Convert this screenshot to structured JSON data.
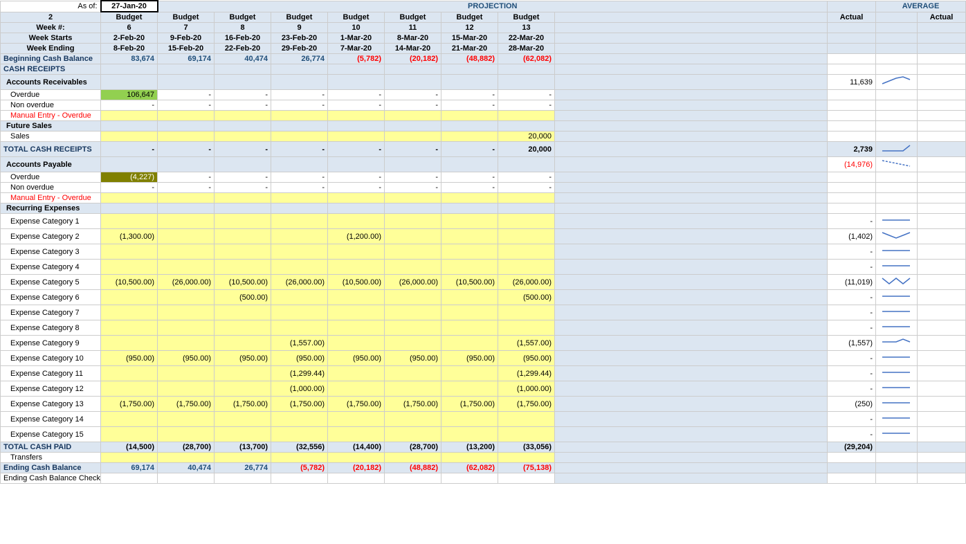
{
  "header": {
    "as_of_label": "As of:",
    "as_of_value": "27-Jan-20",
    "row2": "2",
    "projection_label": "PROJECTION",
    "average_label": "AVERAGE",
    "week_label": "Week #:",
    "week_starts": "Week Starts",
    "week_ending": "Week Ending",
    "col_actual1": "Actual",
    "col_actual2": "Actual"
  },
  "columns": [
    {
      "budget": "Budget",
      "week": "6",
      "start": "2-Feb-20",
      "end": "8-Feb-20"
    },
    {
      "budget": "Budget",
      "week": "7",
      "start": "9-Feb-20",
      "end": "15-Feb-20"
    },
    {
      "budget": "Budget",
      "week": "8",
      "start": "16-Feb-20",
      "end": "22-Feb-20"
    },
    {
      "budget": "Budget",
      "week": "9",
      "start": "23-Feb-20",
      "end": "29-Feb-20"
    },
    {
      "budget": "Budget",
      "week": "10",
      "start": "1-Mar-20",
      "end": "7-Mar-20"
    },
    {
      "budget": "Budget",
      "week": "11",
      "start": "8-Mar-20",
      "end": "14-Mar-20"
    },
    {
      "budget": "Budget",
      "week": "12",
      "start": "15-Mar-20",
      "end": "21-Mar-20"
    },
    {
      "budget": "Budget",
      "week": "13",
      "start": "22-Mar-20",
      "end": "28-Mar-20"
    }
  ],
  "rows": {
    "beginning_cash_balance": {
      "label": "Beginning Cash Balance",
      "values": [
        "83,674",
        "69,174",
        "40,474",
        "26,774",
        "(5,782)",
        "(20,182)",
        "(48,882)",
        "(62,082)"
      ],
      "red": [
        false,
        false,
        false,
        false,
        true,
        true,
        true,
        true
      ]
    },
    "cash_receipts": "CASH RECEIPTS",
    "accounts_receivables": "Accounts Receivables",
    "overdue_ar": {
      "label": "Overdue",
      "cell_value": "106,647",
      "values": [
        "-",
        "-",
        "-",
        "-",
        "-",
        "-",
        "-",
        "-"
      ],
      "avg": "11,639"
    },
    "non_overdue_ar": {
      "label": "Non overdue",
      "values": [
        "-",
        "-",
        "-",
        "-",
        "-",
        "-",
        "-",
        "-"
      ]
    },
    "manual_entry_overdue_ar": "Manual Entry - Overdue",
    "future_sales": "Future Sales",
    "sales": {
      "label": "Sales",
      "values": [
        "",
        "",
        "",
        "",
        "",
        "",
        "",
        "20,000"
      ],
      "avg": ""
    },
    "total_cash_receipts": {
      "label": "TOTAL CASH RECEIPTS",
      "values": [
        "-",
        "-",
        "-",
        "-",
        "-",
        "-",
        "-",
        "20,000"
      ],
      "avg": "2,739"
    },
    "accounts_payable": "Accounts Payable",
    "overdue_ap": {
      "label": "Overdue",
      "cell_value": "(4,227)",
      "values": [
        "-",
        "-",
        "-",
        "-",
        "-",
        "-",
        "-",
        "-"
      ],
      "avg": "(14,976)"
    },
    "non_overdue_ap": {
      "label": "Non overdue",
      "values": [
        "-",
        "-",
        "-",
        "-",
        "-",
        "-",
        "-",
        "-"
      ]
    },
    "manual_entry_overdue_ap": "Manual Entry - Overdue",
    "recurring_expenses": "Recurring Expenses",
    "exp1": {
      "label": "Expense Category 1",
      "values": [
        "",
        "",
        "",
        "",
        "",
        "",
        "",
        ""
      ],
      "avg": "-"
    },
    "exp2": {
      "label": "Expense Category 2",
      "values": [
        "(1,300.00)",
        "",
        "",
        "",
        "(1,200.00)",
        "",
        "",
        ""
      ],
      "avg": "(1,402)"
    },
    "exp3": {
      "label": "Expense Category 3",
      "values": [
        "",
        "",
        "",
        "",
        "",
        "",
        "",
        ""
      ],
      "avg": "-"
    },
    "exp4": {
      "label": "Expense Category 4",
      "values": [
        "",
        "",
        "",
        "",
        "",
        "",
        "",
        ""
      ],
      "avg": "-"
    },
    "exp5": {
      "label": "Expense Category 5",
      "values": [
        "(10,500.00)",
        "(26,000.00)",
        "(10,500.00)",
        "(26,000.00)",
        "(10,500.00)",
        "(26,000.00)",
        "(10,500.00)",
        "(26,000.00)"
      ],
      "avg": "(11,019)"
    },
    "exp6": {
      "label": "Expense Category 6",
      "values": [
        "",
        "",
        "(500.00)",
        "",
        "",
        "",
        "",
        "(500.00)"
      ],
      "avg": "-"
    },
    "exp7": {
      "label": "Expense Category 7",
      "values": [
        "",
        "",
        "",
        "",
        "",
        "",
        "",
        ""
      ],
      "avg": "-"
    },
    "exp8": {
      "label": "Expense Category 8",
      "values": [
        "",
        "",
        "",
        "",
        "",
        "",
        "",
        ""
      ],
      "avg": "-"
    },
    "exp9": {
      "label": "Expense Category 9",
      "values": [
        "",
        "",
        "",
        "(1,557.00)",
        "",
        "",
        "",
        "(1,557.00)"
      ],
      "avg": "(1,557)"
    },
    "exp10": {
      "label": "Expense Category 10",
      "values": [
        "(950.00)",
        "(950.00)",
        "(950.00)",
        "(950.00)",
        "(950.00)",
        "(950.00)",
        "(950.00)",
        "(950.00)"
      ],
      "avg": "-"
    },
    "exp11": {
      "label": "Expense Category 11",
      "values": [
        "",
        "",
        "",
        "(1,299.44)",
        "",
        "",
        "",
        "(1,299.44)"
      ],
      "avg": "-"
    },
    "exp12": {
      "label": "Expense Category 12",
      "values": [
        "",
        "",
        "",
        "(1,000.00)",
        "",
        "",
        "",
        "(1,000.00)"
      ],
      "avg": "-"
    },
    "exp13": {
      "label": "Expense Category 13",
      "values": [
        "(1,750.00)",
        "(1,750.00)",
        "(1,750.00)",
        "(1,750.00)",
        "(1,750.00)",
        "(1,750.00)",
        "(1,750.00)",
        "(1,750.00)"
      ],
      "avg": "(250)"
    },
    "exp14": {
      "label": "Expense Category 14",
      "values": [
        "",
        "",
        "",
        "",
        "",
        "",
        "",
        ""
      ],
      "avg": "-"
    },
    "exp15": {
      "label": "Expense Category 15",
      "values": [
        "",
        "",
        "",
        "",
        "",
        "",
        "",
        ""
      ],
      "avg": "-"
    },
    "total_cash_paid": {
      "label": "TOTAL CASH PAID",
      "values": [
        "(14,500)",
        "(28,700)",
        "(13,700)",
        "(32,556)",
        "(14,400)",
        "(28,700)",
        "(13,200)",
        "(33,056)"
      ],
      "avg": "(29,204)"
    },
    "transfers": "Transfers",
    "ending_cash_balance": {
      "label": "Ending Cash Balance",
      "values": [
        "69,174",
        "40,474",
        "26,774",
        "(5,782)",
        "(20,182)",
        "(48,882)",
        "(62,082)",
        "(75,138)"
      ],
      "red": [
        false,
        false,
        false,
        true,
        true,
        true,
        true,
        true
      ]
    },
    "ending_cash_balance_check": "Ending Cash Balance Check"
  }
}
